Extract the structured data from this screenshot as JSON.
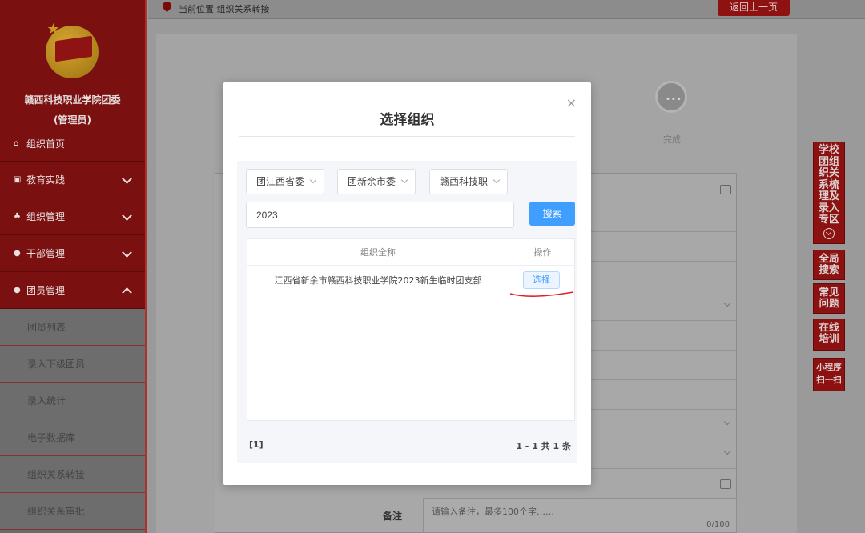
{
  "sidebar": {
    "org_name": "赣西科技职业学院团委",
    "role": "(管理员)",
    "home": "组织首页",
    "menus": [
      {
        "label": "教育实践",
        "icon": "edit-square-icon"
      },
      {
        "label": "组织管理",
        "icon": "sitemap-icon"
      },
      {
        "label": "干部管理",
        "icon": "users-icon"
      },
      {
        "label": "团员管理",
        "icon": "users-icon"
      }
    ],
    "sub_items": [
      "团员列表",
      "录入下级团员",
      "录入统计",
      "电子数据库",
      "组织关系转接",
      "组织关系审批"
    ]
  },
  "topbar": {
    "breadcrumb": "当前位置 组织关系转接",
    "back_label": "返回上一页"
  },
  "steps": {
    "done_label": "完成"
  },
  "form": {
    "remark_label": "备注",
    "remark_placeholder": "请输入备注，最多100个字……",
    "remark_count": "0/100"
  },
  "right_buttons": {
    "special": "学校团组织关系梳理及录入专区",
    "search": "全局搜索",
    "faq": "常见问题",
    "training": "在线培训",
    "miniapp": "小程序扫一扫"
  },
  "modal": {
    "title": "选择组织",
    "close": "×",
    "selects": [
      "团江西省委",
      "团新余市委",
      "赣西科技职业学院"
    ],
    "search_value": "2023",
    "search_button": "搜索",
    "table": {
      "col_name": "组织全称",
      "col_op": "操作",
      "rows": [
        {
          "name": "江西省新余市赣西科技职业学院2023新生临时团支部",
          "action": "选择"
        }
      ]
    },
    "pager_current": "[1]",
    "pager_total": "1 - 1   共 1 条"
  },
  "colors": {
    "brand_red": "#8c1111",
    "primary_blue": "#409eff",
    "annotation_red": "#e0202a"
  }
}
